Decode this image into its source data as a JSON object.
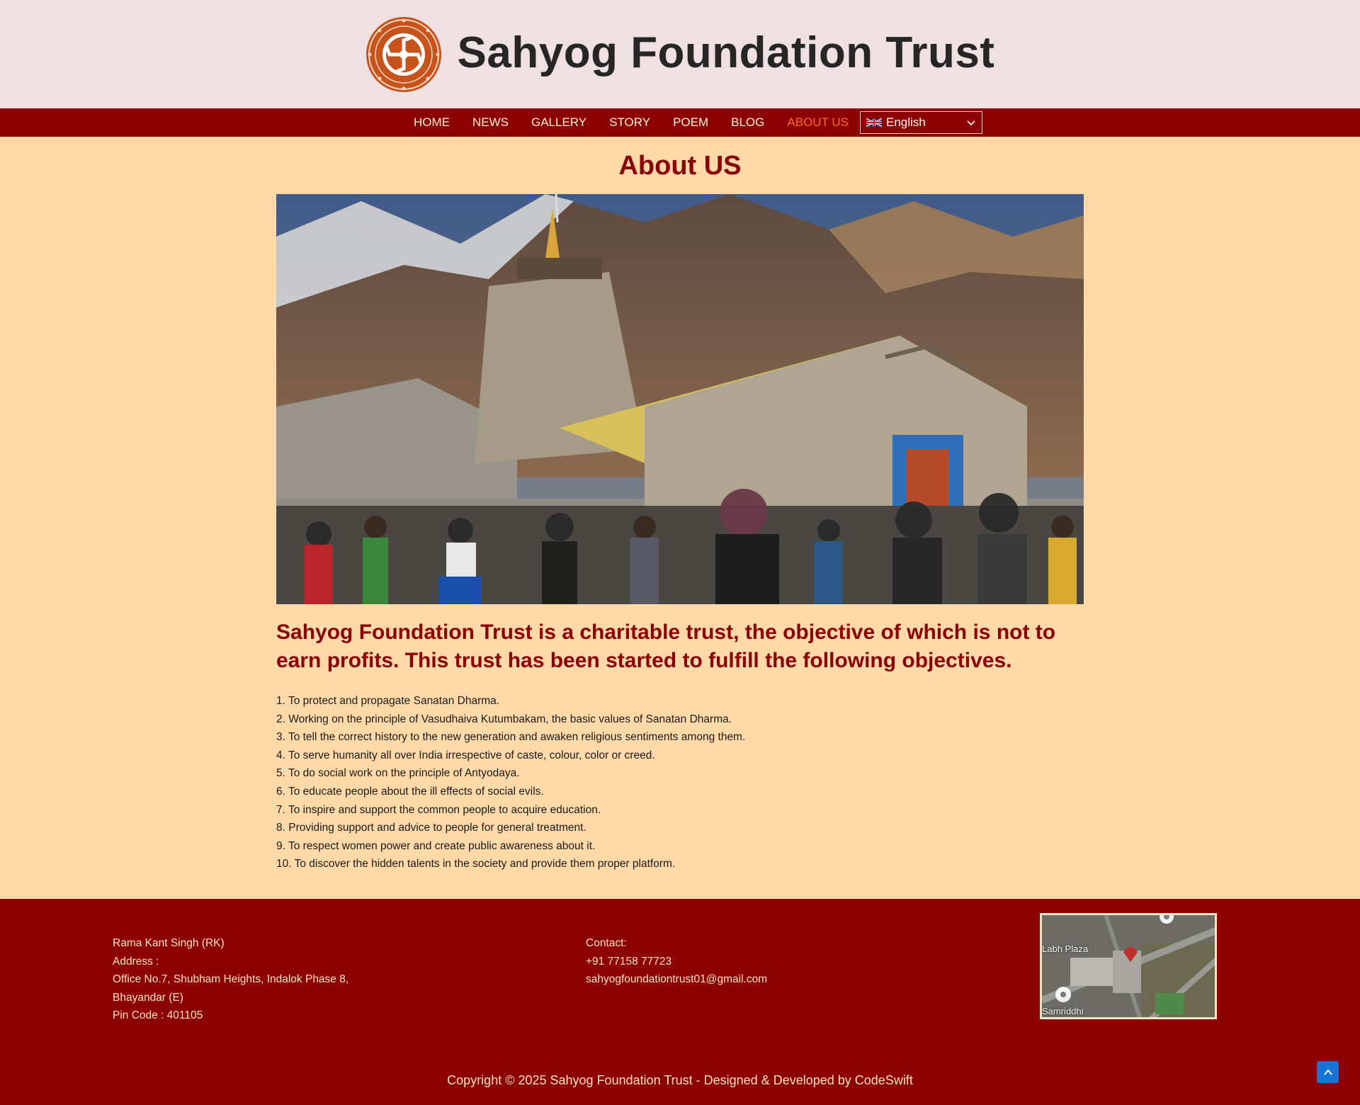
{
  "header": {
    "site_title": "Sahyog Foundation Trust",
    "logo_icon": "dharma-wheel-logo"
  },
  "nav": {
    "items": [
      {
        "label": "HOME",
        "active": false
      },
      {
        "label": "NEWS",
        "active": false
      },
      {
        "label": "GALLERY",
        "active": false
      },
      {
        "label": "STORY",
        "active": false
      },
      {
        "label": "POEM",
        "active": false
      },
      {
        "label": "BLOG",
        "active": false
      },
      {
        "label": "ABOUT US",
        "active": true
      }
    ],
    "language": "English"
  },
  "main": {
    "page_title": "About US",
    "lead": "Sahyog Foundation Trust is a charitable trust, the objective of which is not to earn profits. This trust has been started to fulfill the following objectives.",
    "objectives": [
      "1. To protect and propagate Sanatan Dharma.",
      "2. Working on the principle of Vasudhaiva Kutumbakam, the basic values of Sanatan Dharma.",
      "3. To tell the correct history to the new generation and awaken religious sentiments among them.",
      "4. To serve humanity all over India irrespective of caste, colour, color or creed.",
      "5. To do social work on the principle of Antyodaya.",
      "6. To educate people about the ill effects of social evils.",
      "7. To inspire and support the common people to acquire education.",
      "8. Providing support and advice to people for general treatment.",
      "9. To respect women power and create public awareness about it.",
      "10. To discover the hidden talents in the society and provide them proper platform."
    ]
  },
  "footer": {
    "address_lines": [
      "Rama Kant Singh (RK)",
      "Address :",
      "Office No.7, Shubham Heights, Indalok Phase 8,",
      "Bhayandar (E)",
      "Pin Code : 401105"
    ],
    "contact_lines": [
      "Contact:",
      "+91 77158 77723",
      "sahyogfoundationtrust01@gmail.com"
    ],
    "map_labels": [
      "Labh Plaza",
      "Samriddhi"
    ],
    "copyright": "Copyright © 2025 Sahyog Foundation Trust - Designed & Developed by CodeSwift"
  },
  "colors": {
    "brand_maroon": "#8b0000",
    "page_bg": "#ffd9a7",
    "header_bg": "#efe1e1",
    "active_nav": "#ff6a2a",
    "scroll_top": "#1674d6"
  }
}
